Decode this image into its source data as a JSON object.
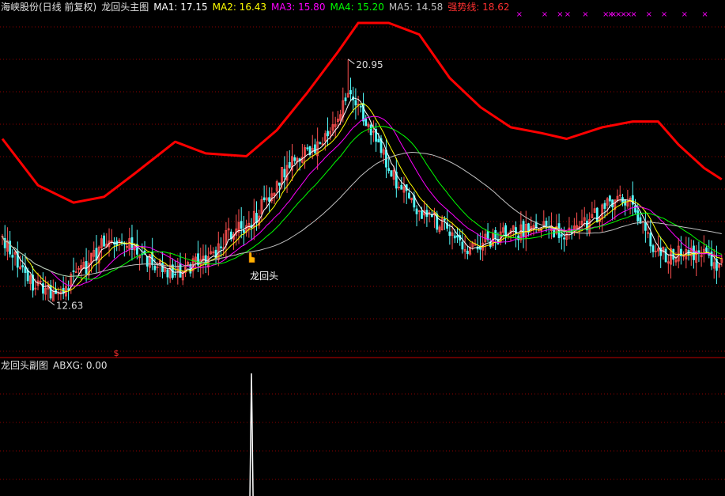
{
  "main_header": {
    "stock": "海峡股份(日线 前复权)",
    "indicator": "龙回头主图",
    "ma1": "MA1: 17.15",
    "ma2": "MA2: 16.43",
    "ma3": "MA3: 15.80",
    "ma4": "MA4: 15.20",
    "ma5": "MA5: 14.58",
    "strong": "强势线: 18.62"
  },
  "sub_header": {
    "title": "龙回头副图",
    "abxg": "ABXG: 0.00"
  },
  "colors": {
    "background": "#000000",
    "up": "#ff5050",
    "down": "#54fcfc",
    "ma1": "#ffffff",
    "ma2": "#ffff00",
    "ma3": "#ff00ff",
    "ma4": "#00ff00",
    "ma5": "#c0c0c0",
    "strong": "#ff0000",
    "grid": "#8b0000",
    "signal": "#ff00ff"
  },
  "chart_data": [
    {
      "type": "candlestick",
      "title": "龙回头主图",
      "ylim": [
        11.2,
        22.5
      ],
      "high_marker": "20.95",
      "low_marker": "12.63",
      "signal_label": "龙回头",
      "signal_icon": "hand-pointer-icon",
      "sell_marker": "$",
      "signal_marker": "×",
      "close_anchors": [
        [
          0,
          14.8
        ],
        [
          10,
          13.3
        ],
        [
          18,
          12.9
        ],
        [
          25,
          13.1
        ],
        [
          33,
          13.8
        ],
        [
          42,
          14.9
        ],
        [
          50,
          14.6
        ],
        [
          58,
          14.0
        ],
        [
          66,
          13.6
        ],
        [
          74,
          13.8
        ],
        [
          82,
          14.1
        ],
        [
          90,
          15.0
        ],
        [
          98,
          15.3
        ],
        [
          106,
          16.4
        ],
        [
          114,
          17.5
        ],
        [
          120,
          17.7
        ],
        [
          126,
          18.0
        ],
        [
          132,
          18.7
        ],
        [
          136,
          20.0
        ],
        [
          140,
          19.4
        ],
        [
          146,
          18.4
        ],
        [
          152,
          17.2
        ],
        [
          158,
          16.3
        ],
        [
          164,
          15.6
        ],
        [
          170,
          15.4
        ],
        [
          176,
          15.1
        ],
        [
          182,
          14.3
        ],
        [
          190,
          14.7
        ],
        [
          198,
          14.9
        ],
        [
          206,
          15.0
        ],
        [
          214,
          15.1
        ],
        [
          222,
          15.0
        ],
        [
          230,
          15.3
        ],
        [
          238,
          15.9
        ],
        [
          244,
          16.2
        ],
        [
          250,
          15.6
        ],
        [
          256,
          14.4
        ],
        [
          262,
          14.2
        ],
        [
          270,
          14.3
        ],
        [
          278,
          14.1
        ],
        [
          283,
          13.8
        ]
      ],
      "lines": [
        {
          "name": "MA1",
          "period": 5,
          "color": "#ffffff"
        },
        {
          "name": "MA2",
          "period": 10,
          "color": "#ffff00"
        },
        {
          "name": "MA3",
          "period": 20,
          "color": "#ff00ff"
        },
        {
          "name": "MA4",
          "period": 30,
          "color": "#00ff00"
        },
        {
          "name": "MA5",
          "period": 60,
          "color": "#c0c0c0"
        },
        {
          "name": "强势线",
          "color": "#ff0000",
          "points": [
            [
              0,
              18.2
            ],
            [
              14,
              16.6
            ],
            [
              28,
              16.0
            ],
            [
              40,
              16.2
            ],
            [
              52,
              17.0
            ],
            [
              68,
              18.1
            ],
            [
              80,
              17.7
            ],
            [
              96,
              17.6
            ],
            [
              108,
              18.5
            ],
            [
              120,
              19.8
            ],
            [
              132,
              21.2
            ],
            [
              140,
              22.2
            ],
            [
              152,
              22.2
            ],
            [
              164,
              21.8
            ],
            [
              176,
              20.3
            ],
            [
              188,
              19.3
            ],
            [
              200,
              18.6
            ],
            [
              212,
              18.4
            ],
            [
              222,
              18.2
            ],
            [
              236,
              18.6
            ],
            [
              248,
              18.8
            ],
            [
              258,
              18.8
            ],
            [
              266,
              18.0
            ],
            [
              276,
              17.2
            ],
            [
              283,
              16.8
            ]
          ]
        }
      ]
    },
    {
      "type": "line",
      "title": "龙回头副图",
      "series": [
        {
          "name": "ABXG",
          "spike_index": 98,
          "value_label": "0.00"
        }
      ]
    }
  ]
}
